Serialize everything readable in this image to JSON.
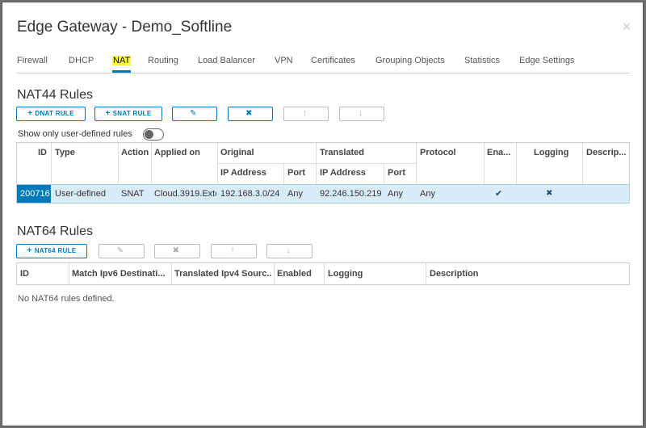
{
  "window": {
    "title": "Edge Gateway - Demo_Softline"
  },
  "tabs": [
    {
      "label": "Firewall"
    },
    {
      "label": "DHCP"
    },
    {
      "label": "NAT"
    },
    {
      "label": "Routing"
    },
    {
      "label": "Load Balancer"
    },
    {
      "label": "VPN"
    },
    {
      "label": "Certificates"
    },
    {
      "label": "Grouping Objects"
    },
    {
      "label": "Statistics"
    },
    {
      "label": "Edge Settings"
    }
  ],
  "active_tab": "NAT",
  "nat44": {
    "title": "NAT44 Rules",
    "buttons": {
      "dnat": "DNAT RULE",
      "snat": "SNAT RULE"
    },
    "toggle_label": "Show only user-defined rules",
    "headers": {
      "id": "ID",
      "type": "Type",
      "action": "Action",
      "applied_on": "Applied on",
      "original": "Original",
      "translated": "Translated",
      "protocol": "Protocol",
      "enabled": "Ena...",
      "logging": "Logging",
      "description": "Descrip...",
      "ip_address": "IP Address",
      "port": "Port"
    },
    "rows": [
      {
        "id": "200716",
        "type": "User-defined",
        "action": "SNAT",
        "applied_on": "Cloud.3919.Exte",
        "orig_ip": "192.168.3.0/24",
        "orig_port": "Any",
        "trans_ip": "92.246.150.219",
        "trans_port": "Any",
        "protocol": "Any",
        "enabled": "✔",
        "logging": "✖",
        "description": ""
      }
    ]
  },
  "nat64": {
    "title": "NAT64 Rules",
    "buttons": {
      "add": "NAT64 RULE"
    },
    "headers": {
      "id": "ID",
      "match": "Match Ipv6 Destinati...",
      "translated": "Translated Ipv4 Sourc...",
      "enabled": "Enabled",
      "logging": "Logging",
      "description": "Description"
    },
    "empty_message": "No NAT64 rules defined."
  },
  "icons": {
    "plus": "+",
    "edit": "✎",
    "delete": "✖",
    "up": "↑",
    "down": "↓",
    "close": "×"
  },
  "colors": {
    "accent": "#0079b8",
    "tab_highlight": "#ffff33",
    "selected_row": "#d9ebf7"
  }
}
